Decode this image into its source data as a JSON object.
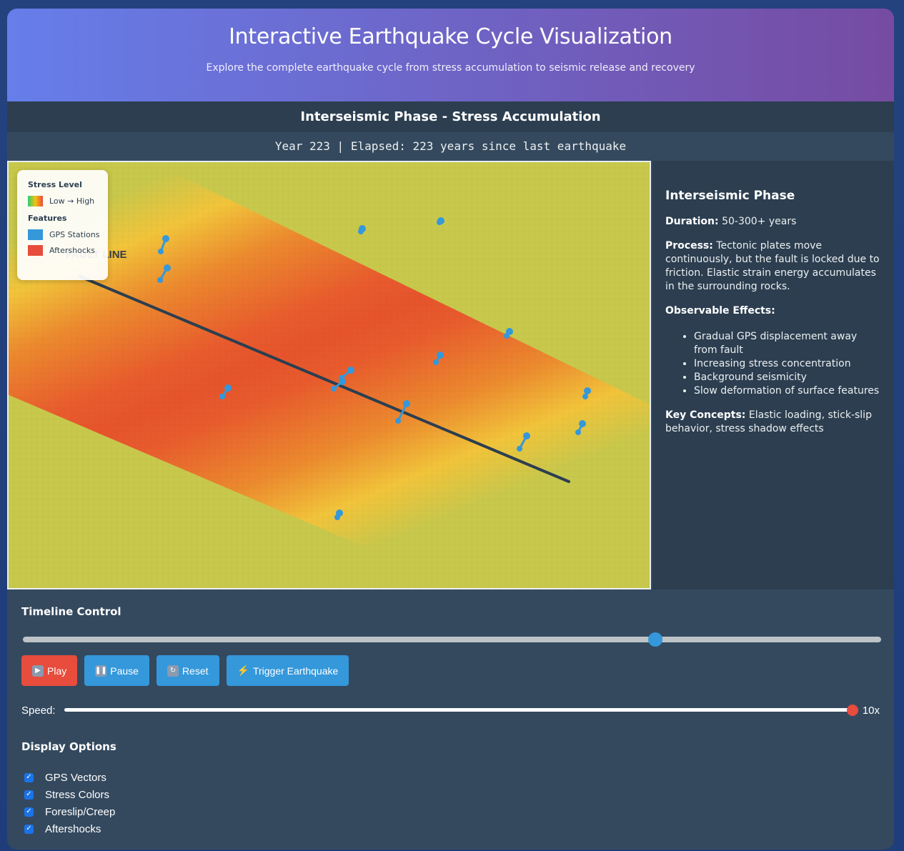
{
  "header": {
    "title": "Interactive Earthquake Cycle Visualization",
    "subtitle": "Explore the complete earthquake cycle from stress accumulation to seismic release and recovery"
  },
  "phase_title": "Interseismic Phase - Stress Accumulation",
  "year_status": "Year 223 | Elapsed: 223 years since last earthquake",
  "visualization": {
    "fault_label": "FAULT LINE",
    "legend": {
      "stress_title": "Stress Level",
      "stress_range": "Low → High",
      "features_title": "Features",
      "gps_label": "GPS Stations",
      "aftershocks_label": "Aftershocks"
    },
    "colors": {
      "gps": "#3498db",
      "aftershocks": "#e74c3c",
      "fault": "#2c3e50",
      "stress_low": "#c8c84c",
      "stress_mid": "#f4c13c",
      "stress_high": "#e85a2c"
    }
  },
  "info": {
    "title": "Interseismic Phase",
    "duration_label": "Duration:",
    "duration_value": "50-300+ years",
    "process_label": "Process:",
    "process_value": "Tectonic plates move continuously, but the fault is locked due to friction. Elastic strain energy accumulates in the surrounding rocks.",
    "effects_label": "Observable Effects:",
    "effects": [
      "Gradual GPS displacement away from fault",
      "Increasing stress concentration",
      "Background seismicity",
      "Slow deformation of surface features"
    ],
    "concepts_label": "Key Concepts:",
    "concepts_value": "Elastic loading, stick-slip behavior, stress shadow effects"
  },
  "controls": {
    "timeline_title": "Timeline Control",
    "timeline_value": 0.737,
    "buttons": {
      "play": "Play",
      "pause": "Pause",
      "reset": "Reset",
      "trigger": "Trigger Earthquake"
    },
    "speed_label": "Speed:",
    "speed_value": "10x",
    "speed_fraction": 1.0,
    "display_title": "Display Options",
    "options": [
      {
        "label": "GPS Vectors",
        "checked": true
      },
      {
        "label": "Stress Colors",
        "checked": true
      },
      {
        "label": "Foreslip/Creep",
        "checked": true
      },
      {
        "label": "Aftershocks",
        "checked": true
      }
    ]
  }
}
